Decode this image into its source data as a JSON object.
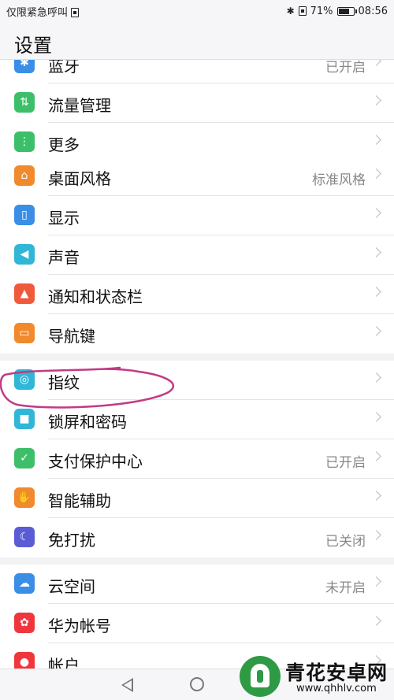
{
  "status": {
    "left_text": "仅限紧急呼叫",
    "battery_percent": "71%",
    "time": "08:56"
  },
  "header": {
    "title": "设置"
  },
  "groups": [
    {
      "items": [
        {
          "label": "蓝牙",
          "value": "已开启",
          "icon": "bluetooth-icon",
          "color": "#3a8ee6"
        },
        {
          "label": "流量管理",
          "value": "",
          "icon": "data-usage-icon",
          "color": "#3dbf6a"
        },
        {
          "label": "更多",
          "value": "",
          "icon": "more-dots-icon",
          "color": "#3dbf6a"
        }
      ]
    },
    {
      "items": [
        {
          "label": "桌面风格",
          "value": "标准风格",
          "icon": "home-icon",
          "color": "#f08a2c"
        },
        {
          "label": "显示",
          "value": "",
          "icon": "display-icon",
          "color": "#3a8ee6"
        },
        {
          "label": "声音",
          "value": "",
          "icon": "speaker-icon",
          "color": "#30b6d6"
        },
        {
          "label": "通知和状态栏",
          "value": "",
          "icon": "bell-icon",
          "color": "#f05a3c"
        },
        {
          "label": "导航键",
          "value": "",
          "icon": "navigation-key-icon",
          "color": "#f08a2c"
        }
      ]
    },
    {
      "items": [
        {
          "label": "指纹",
          "value": "",
          "icon": "fingerprint-icon",
          "color": "#30b6d6"
        },
        {
          "label": "锁屏和密码",
          "value": "",
          "icon": "lock-icon",
          "color": "#30b6d6"
        },
        {
          "label": "支付保护中心",
          "value": "已开启",
          "icon": "shield-check-icon",
          "color": "#3dbf6a"
        },
        {
          "label": "智能辅助",
          "value": "",
          "icon": "hand-icon",
          "color": "#f08a2c"
        },
        {
          "label": "免打扰",
          "value": "已关闭",
          "icon": "moon-icon",
          "color": "#5b5bd6"
        }
      ]
    },
    {
      "items": [
        {
          "label": "云空间",
          "value": "未开启",
          "icon": "cloud-icon",
          "color": "#3a8ee6"
        },
        {
          "label": "华为帐号",
          "value": "",
          "icon": "huawei-logo-icon",
          "color": "#f0363c"
        },
        {
          "label": "帐户",
          "value": "",
          "icon": "account-icon",
          "color": "#f0363c"
        }
      ]
    }
  ],
  "watermark": {
    "title": "青花安卓网",
    "url": "www.qhhlv.com",
    "color": "#2f9a44"
  }
}
